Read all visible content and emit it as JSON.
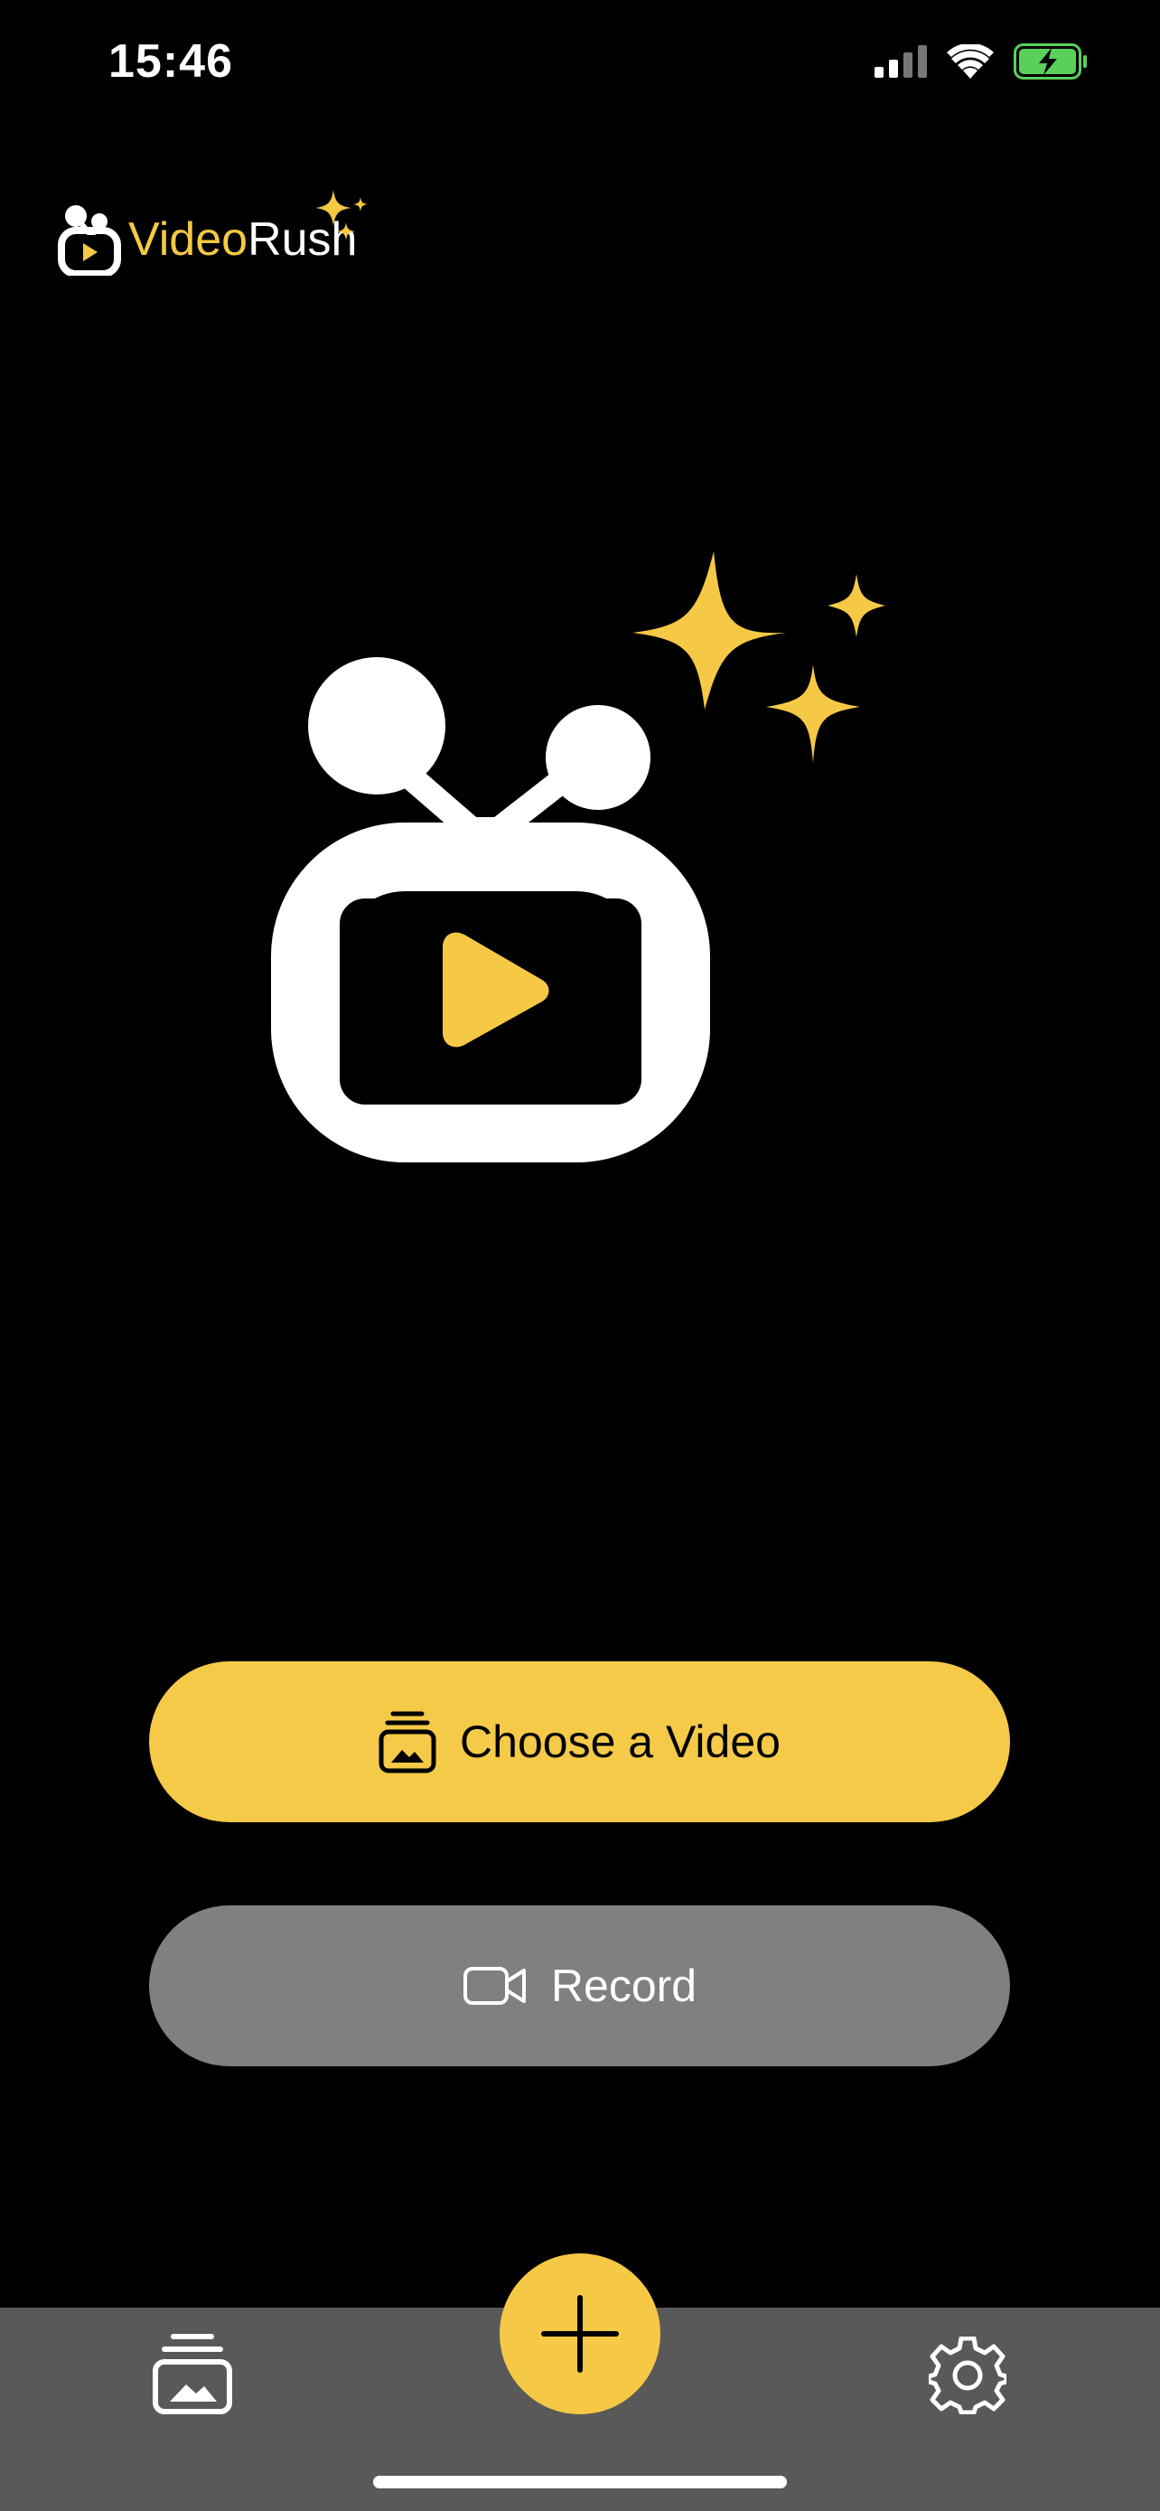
{
  "status_bar": {
    "time": "15:46"
  },
  "app": {
    "brand_part1": "Video",
    "brand_part2": "Rush"
  },
  "actions": {
    "choose_label": "Choose a Video",
    "record_label": "Record"
  },
  "icons": {
    "choose": "photo-library-icon",
    "record": "video-camera-icon",
    "tab_library": "photo-library-icon",
    "tab_add": "plus-icon",
    "tab_settings": "gear-icon"
  },
  "colors": {
    "accent": "#f5c945",
    "background": "#000000",
    "secondary_button": "#808080",
    "tab_bar": "#595959",
    "battery": "#5ad05a"
  }
}
